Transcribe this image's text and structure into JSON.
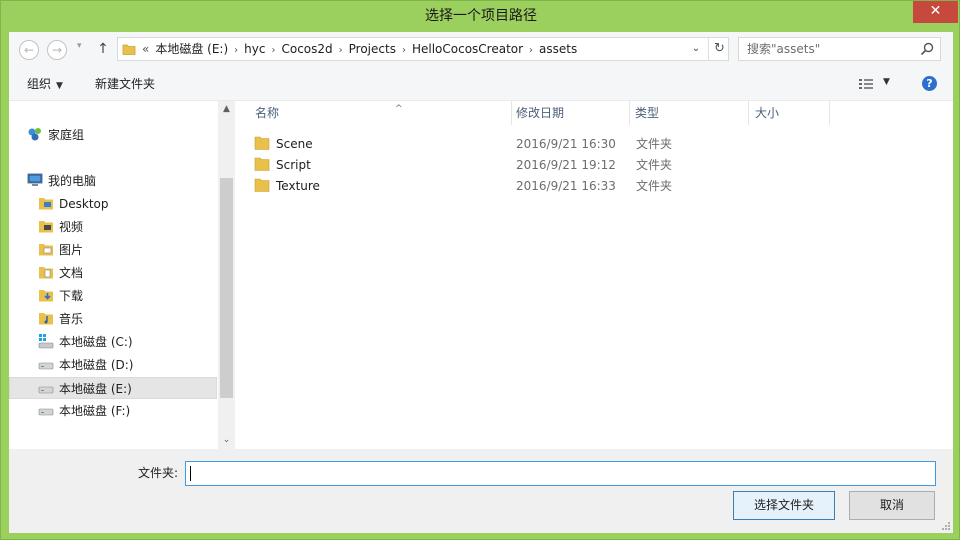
{
  "window": {
    "title": "选择一个项目路径",
    "close_label": "✕"
  },
  "nav": {
    "back_icon": "←",
    "forward_icon": "→",
    "recent_icon": "▾",
    "up_icon": "↑",
    "breadcrumb_prefix": "«",
    "breadcrumbs": [
      "本地磁盘 (E:)",
      "hyc",
      "Cocos2d",
      "Projects",
      "HelloCocosCreator",
      "assets"
    ],
    "crumb_sep": "›",
    "dropdown_icon": "⌄",
    "refresh_icon": "↻",
    "search_placeholder": "搜索\"assets\""
  },
  "toolbar": {
    "organize_label": "组织",
    "organize_caret": "▼",
    "new_folder_label": "新建文件夹",
    "view_caret": "▼",
    "help_label": "?"
  },
  "sidebar": {
    "items": [
      {
        "label": "家庭组",
        "icon": "homegroup-icon"
      },
      {
        "label": "我的电脑",
        "icon": "computer-icon"
      },
      {
        "label": "Desktop",
        "icon": "desktop-folder-icon"
      },
      {
        "label": "视频",
        "icon": "videos-folder-icon"
      },
      {
        "label": "图片",
        "icon": "pictures-folder-icon"
      },
      {
        "label": "文档",
        "icon": "documents-folder-icon"
      },
      {
        "label": "下载",
        "icon": "downloads-folder-icon"
      },
      {
        "label": "音乐",
        "icon": "music-folder-icon"
      },
      {
        "label": "本地磁盘 (C:)",
        "icon": "system-drive-icon"
      },
      {
        "label": "本地磁盘 (D:)",
        "icon": "drive-icon"
      },
      {
        "label": "本地磁盘 (E:)",
        "icon": "drive-icon",
        "selected": true
      },
      {
        "label": "本地磁盘 (F:)",
        "icon": "drive-icon"
      }
    ],
    "scroll_up": "▲",
    "scroll_down": "⌄"
  },
  "filelist": {
    "columns": [
      "名称",
      "修改日期",
      "类型",
      "大小"
    ],
    "sort_indicator": "^",
    "rows": [
      {
        "name": "Scene",
        "date": "2016/9/21 16:30",
        "type": "文件夹"
      },
      {
        "name": "Script",
        "date": "2016/9/21 19:12",
        "type": "文件夹"
      },
      {
        "name": "Texture",
        "date": "2016/9/21 16:33",
        "type": "文件夹"
      }
    ]
  },
  "bottom": {
    "folder_label": "文件夹:",
    "folder_value": "",
    "select_button": "选择文件夹",
    "cancel_button": "取消"
  },
  "colors": {
    "frame": "#9bcf5e",
    "close": "#c7483c",
    "folder": "#e8c04a",
    "accent": "#3f9ae0"
  }
}
